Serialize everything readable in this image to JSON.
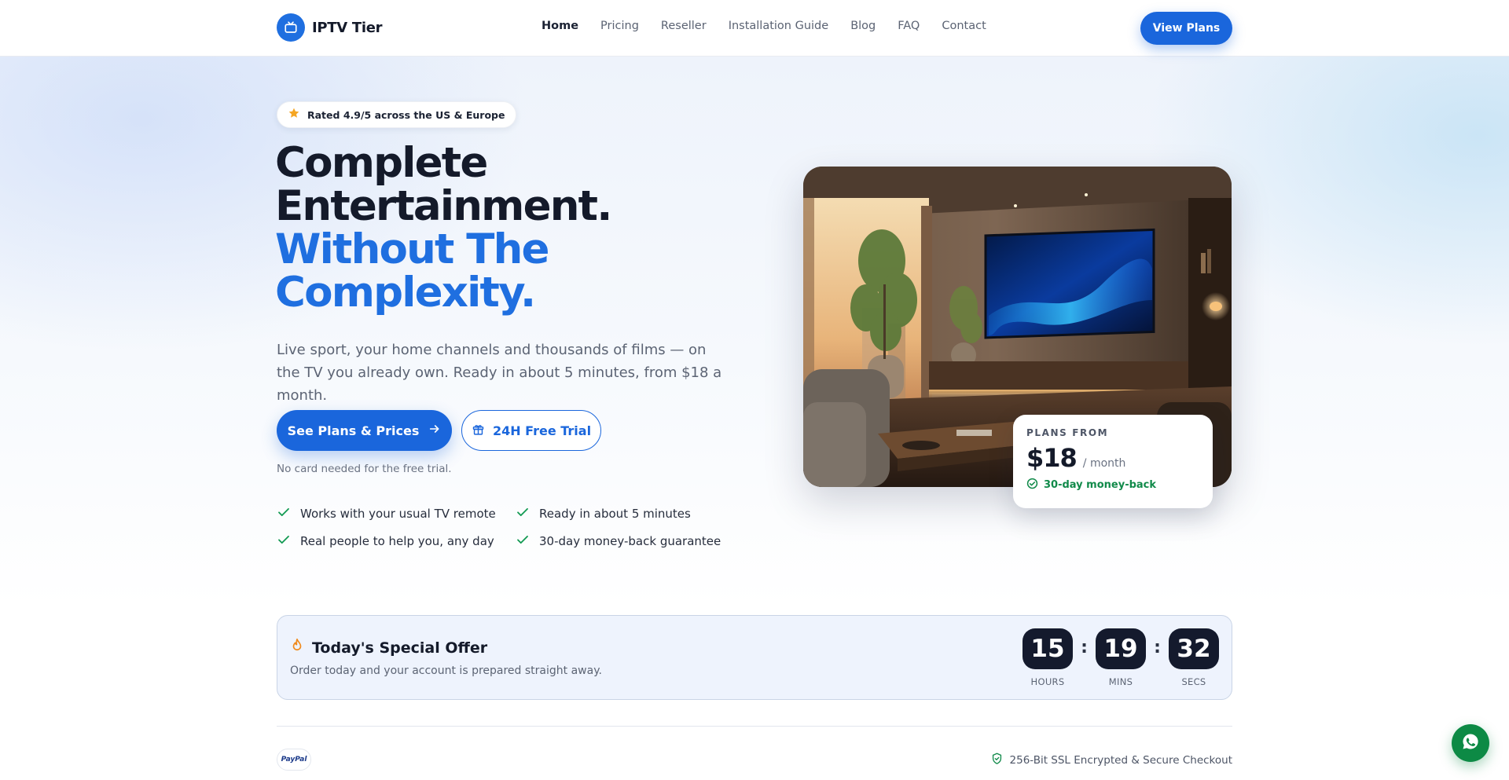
{
  "brand": {
    "name": "IPTV Tier"
  },
  "nav": {
    "items": [
      {
        "label": "Home",
        "active": true
      },
      {
        "label": "Pricing"
      },
      {
        "label": "Reseller"
      },
      {
        "label": "Installation Guide"
      },
      {
        "label": "Blog"
      },
      {
        "label": "FAQ"
      },
      {
        "label": "Contact"
      }
    ],
    "cta_label": "View Plans"
  },
  "hero": {
    "rating_text": "Rated 4.9/5 across the US & Europe",
    "headline_line1": "Complete",
    "headline_line2": "Entertainment.",
    "headline_line3": "Without The",
    "headline_line4": "Complexity.",
    "subtext": "Live sport, your home channels and thousands of films — on the TV you already own. Ready in about 5 minutes, from $18 a month.",
    "primary_button": "See Plans & Prices",
    "secondary_button": "24H Free Trial",
    "note": "No card needed for the free trial.",
    "features": [
      "Works with your usual TV remote",
      "Ready in about 5 minutes",
      "Real people to help you, any day",
      "30-day money-back guarantee"
    ]
  },
  "price_card": {
    "label": "PLANS FROM",
    "amount": "$18",
    "period": "/ month",
    "guarantee": "30-day money-back"
  },
  "offer": {
    "title": "Today's Special Offer",
    "subtitle": "Order today and your account is prepared straight away.",
    "timer": [
      {
        "value": "15",
        "label": "HOURS"
      },
      {
        "value": "19",
        "label": "MINS"
      },
      {
        "value": "32",
        "label": "SECS"
      }
    ]
  },
  "footer_strip": {
    "paypal_label": "PayPal",
    "secure_text": "256-Bit SSL Encrypted & Secure Checkout"
  },
  "colors": {
    "accent": "#1a66dc",
    "brand_blue": "#1f6fe0",
    "success": "#118a4a",
    "timer_bg": "#141a2d",
    "whatsapp": "#0d8a45"
  },
  "icons": [
    "tv-icon",
    "star-icon",
    "arrow-right-icon",
    "gift-icon",
    "check-icon",
    "check-circle-icon",
    "flame-icon",
    "shield-check-icon",
    "whatsapp-icon"
  ]
}
